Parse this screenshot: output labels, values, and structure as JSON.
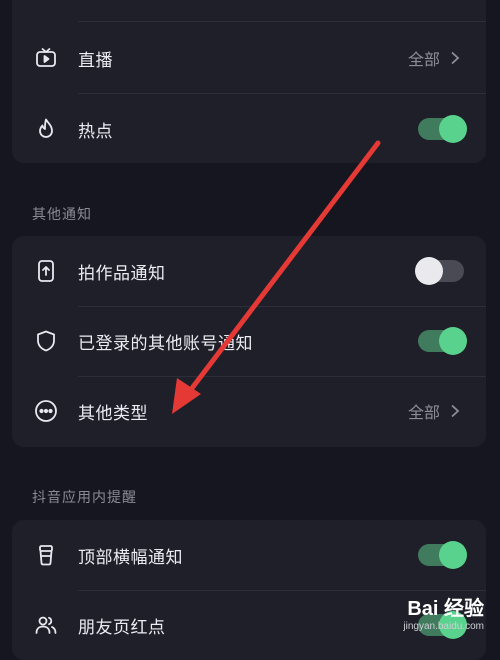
{
  "group1": {
    "items": [
      {
        "label": "直播",
        "value": "全部"
      },
      {
        "label": "热点",
        "toggle": true
      }
    ]
  },
  "section_other": {
    "title": "其他通知",
    "items": [
      {
        "label": "拍作品通知",
        "toggle": false
      },
      {
        "label": "已登录的其他账号通知",
        "toggle": true
      },
      {
        "label": "其他类型",
        "value": "全部"
      }
    ]
  },
  "section_inapp": {
    "title": "抖音应用内提醒",
    "items": [
      {
        "label": "顶部横幅通知",
        "toggle": true
      },
      {
        "label": "朋友页红点",
        "toggle": true
      }
    ]
  },
  "watermark": {
    "brand": "Bai 经验",
    "url": "jingyan.baidu.com"
  },
  "colors": {
    "background": "#161620",
    "card": "#1f1f29",
    "toggle_on": "#58d28d",
    "annotation_arrow": "#e53935"
  }
}
